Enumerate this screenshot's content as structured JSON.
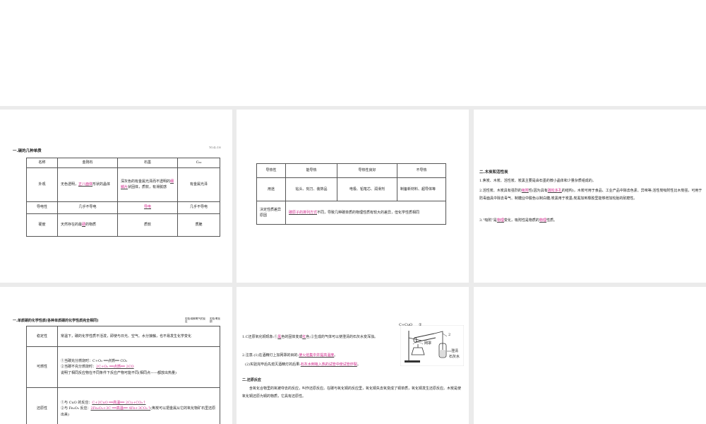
{
  "colors": {
    "background": "#ebebeb",
    "slide": "#ffffff",
    "fill_in": "#d0248a"
  },
  "s1": {
    "heading": "一.碳的几种单质",
    "corner": "TG.42.1N",
    "headers": [
      "名称",
      "金刚石",
      "石墨",
      "C₆₀"
    ],
    "r1": {
      "label": "外观",
      "d_a": "无色透明，",
      "d_fill": "正八面体",
      "d_b": "形状的晶体",
      "g_a": "深灰色的有金属光泽而不透明的",
      "g_fill": "细鳞片",
      "g_b": "状固体，质软，有滑腻感",
      "c60": "有金属光泽"
    },
    "r2": {
      "label": "导电性",
      "d": "几乎不导电",
      "g_fill": "导电",
      "c60": "几乎不导电"
    },
    "r3": {
      "label": "硬度",
      "d_a": "天然存在的最",
      "d_fill": "硬",
      "d_b": "的物质",
      "g": "质软",
      "c60": "质脆"
    }
  },
  "s2": {
    "r1": {
      "label": "导热性",
      "c1": "能导热",
      "c2": "导热性良好",
      "c3": "不导热"
    },
    "r2": {
      "label": "用途",
      "c1": "钻头、刻刀、装饰品",
      "c2": "电极、铅笔芯、润滑剂",
      "c3": "制备新材料、超导体等"
    },
    "r3": {
      "label": "决定性质差异原因",
      "fill": "碳原子的排列方式",
      "text": "不同，导致几种碳单质的物理性质有较大的差异，但化学性质相同"
    }
  },
  "s3": {
    "heading": "二.木炭和活性炭",
    "p1": "1.焦炭、木炭、活性炭、炭黑主要是由石墨的微小晶体和少量杂质组成的。",
    "p2_a": "2.活性炭、木炭具有强烈的",
    "p2_f1": "吸附",
    "p2_b": "性(因为具有",
    "p2_f2": "疏松多孔",
    "p2_c": "的结构)，木炭可用于食品、工业产品中除去色素、异味等;活性炭吸附性比木炭强，可用于防毒面具中除去毒气、制糖业中脱色以制白糖;炭黑用于炭墨;炭黑加到橡胶里能够增加轮胎的耐磨性。",
    "p3_a": "3.“吸附”是",
    "p3_f1": "物理",
    "p3_b": "变化，吸附性是物质的",
    "p3_f2": "物理",
    "p3_c": "性质。"
  },
  "s4": {
    "heading": "一.单质碳的化学性质(各种单质碳的化学性质完全相同)",
    "corner_a": "实验:碳和氧气的反应",
    "corner_b": "实验:氧化铜",
    "stability": {
      "label": "稳定性",
      "text": "常温下，碳的化学性质不活泼，即使与日光、空气、水分接触，也不易发生化学变化"
    },
    "combustion": {
      "label": "可燃性",
      "l1": "①当碳充分燃烧时：C+O₂ ══点燃══ CO₂",
      "l2_a": "②当碳不充分燃烧时：",
      "l2_fill": "2C+O₂ ══点燃══ 2CO",
      "l3": "说明了相同反应物在不同条件下反应产物可能不同(相同点——都放出热量)"
    },
    "reduction": {
      "label": "还原性",
      "l1_a": "①与 CuO 的反应：",
      "l1_fill": "C+2CuO ══高温══ 2Cu+CO₂↑",
      "l2_a": "②与 Fe₂O₃ 反应：",
      "l2_fill": "2Fe₂O₃+3C ══高温══ 4Fe+3CO₂↑",
      "l2_b": "(焦炭可以把金属从它的氧化物矿石里还原出来)"
    }
  },
  "s5": {
    "p1_a": "1.C还原氧化铜现象:①",
    "p1_f1": "黑",
    "p1_b": "色的固体变成",
    "p1_f2": "红",
    "p1_c": "色;②生成的气体可以使澄清的石灰水变浑浊。",
    "p2_a": "2.注意:(1)在酒精灯上加网罩的目的:",
    "p2_fill": "使火焰集中并提高温度",
    "p2_b": "。",
    "p3_a": "(2)实验完毕后先熄灭酒精灯的后果:",
    "p3_fill": "石灰水倒吸入热的试管中使试管炸裂",
    "p3_b": "。",
    "heading": "二.还原反应",
    "p4": "含氧化合物里的氧被夺去的反应，叫作还原反应。在碳与氧化铜的反应里，氧化铜失去氧变成了铜单质，氧化铜发生还原反应。木炭是使氧化铜还原为铜的物质，它具有还原性。",
    "diagram": {
      "reactants": "C+CuO",
      "n1": "①",
      "n2": "2",
      "mesh": "网罩",
      "lime1": "澄清",
      "lime2": "石灰水"
    }
  }
}
